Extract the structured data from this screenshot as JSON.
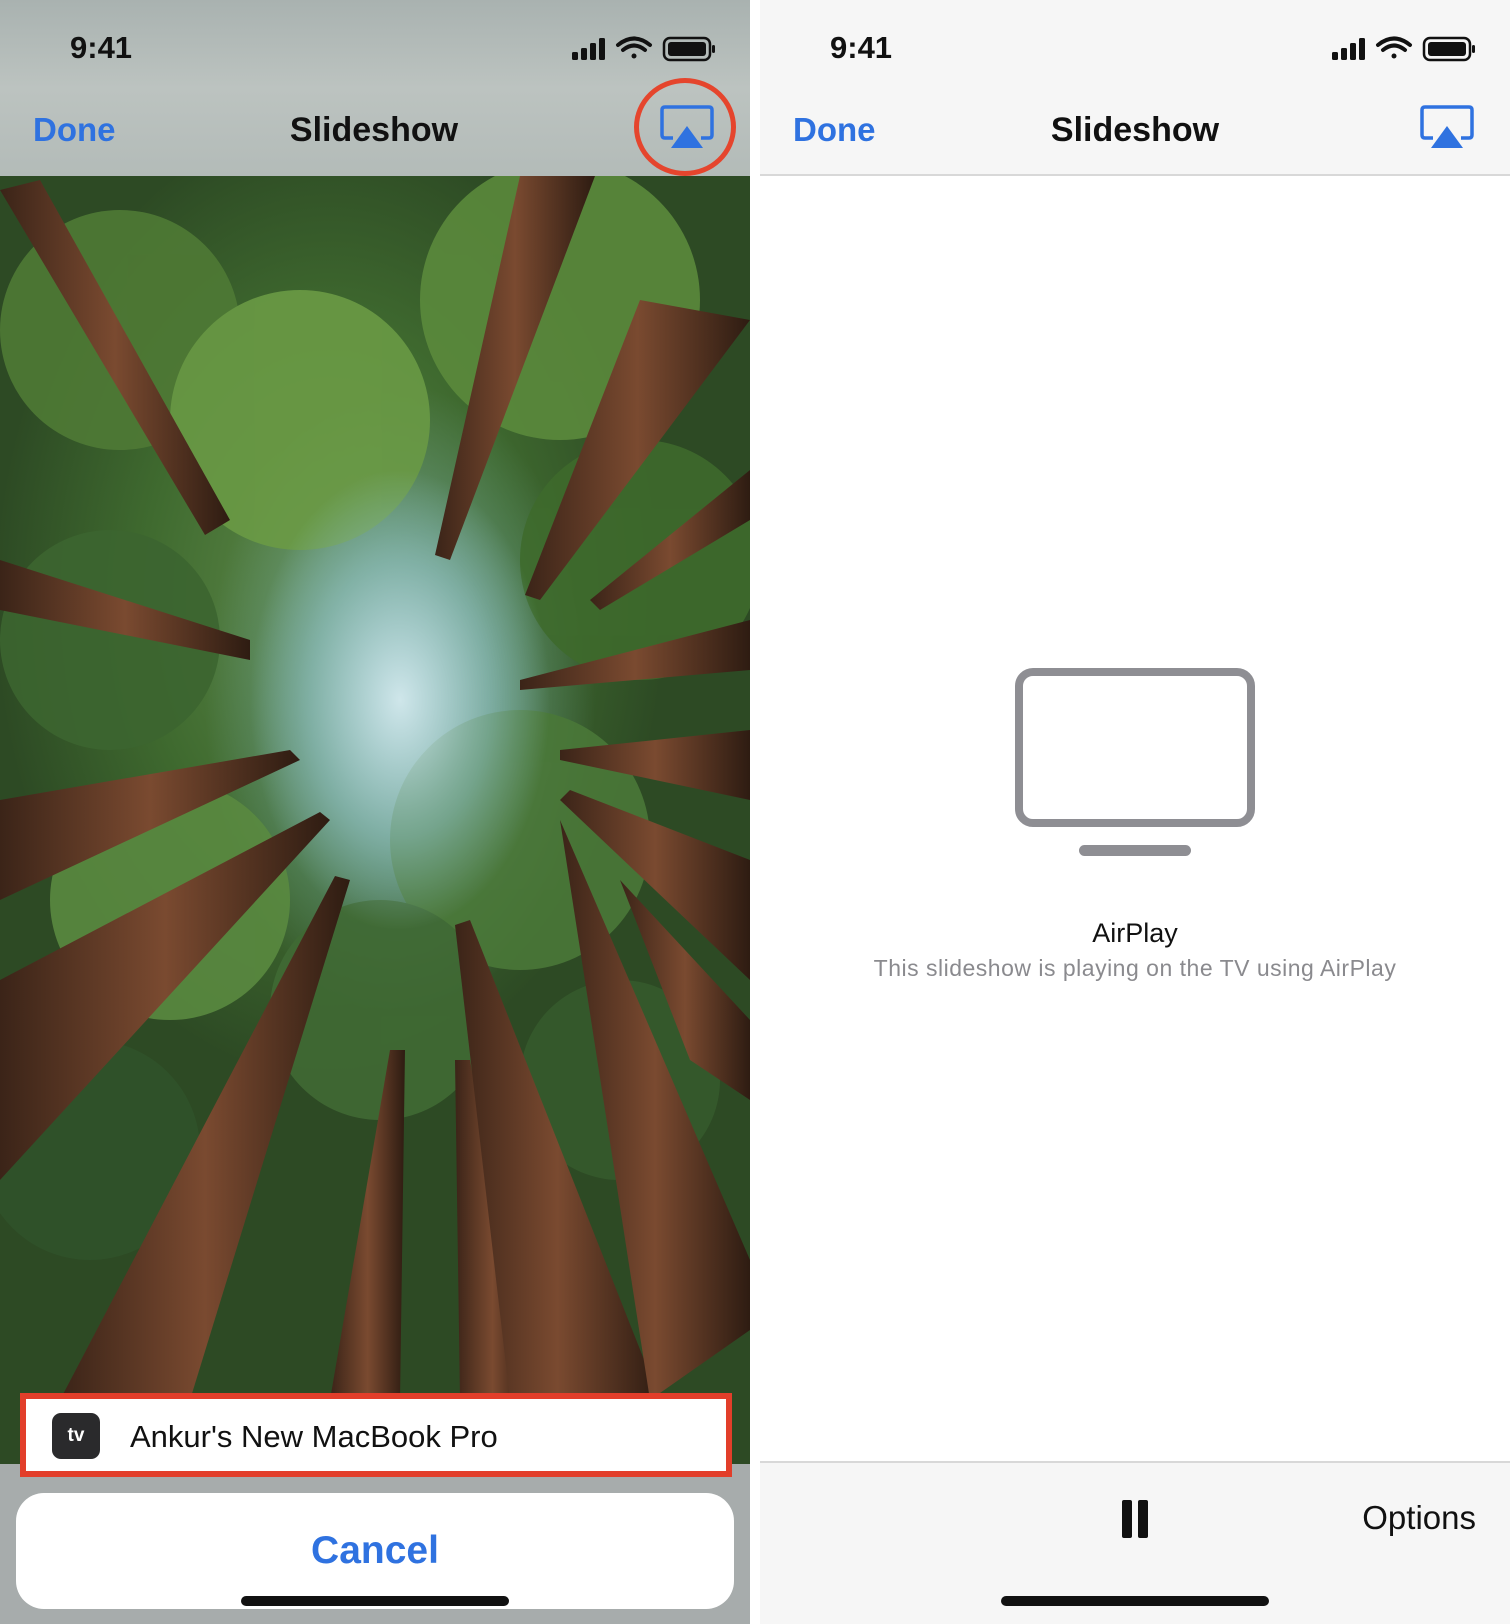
{
  "status_bar": {
    "time": "9:41"
  },
  "left": {
    "nav": {
      "done_label": "Done",
      "title": "Slideshow",
      "airplay_icon": "airplay-icon"
    },
    "airplay_sheet": {
      "device_name": "Ankur's New MacBook Pro",
      "device_badge": "tv",
      "cancel_label": "Cancel"
    }
  },
  "right": {
    "nav": {
      "done_label": "Done",
      "title": "Slideshow",
      "airplay_icon": "airplay-icon"
    },
    "airplay_status": {
      "title": "AirPlay",
      "subtitle": "This slideshow is playing on the TV using AirPlay"
    },
    "toolbar": {
      "pause_icon": "pause-icon",
      "options_label": "Options"
    }
  },
  "colors": {
    "accent_blue": "#2f72e0",
    "highlight_red": "#e23e2a",
    "text_dark": "#111111",
    "subtitle_gray": "#8a8a8e"
  }
}
